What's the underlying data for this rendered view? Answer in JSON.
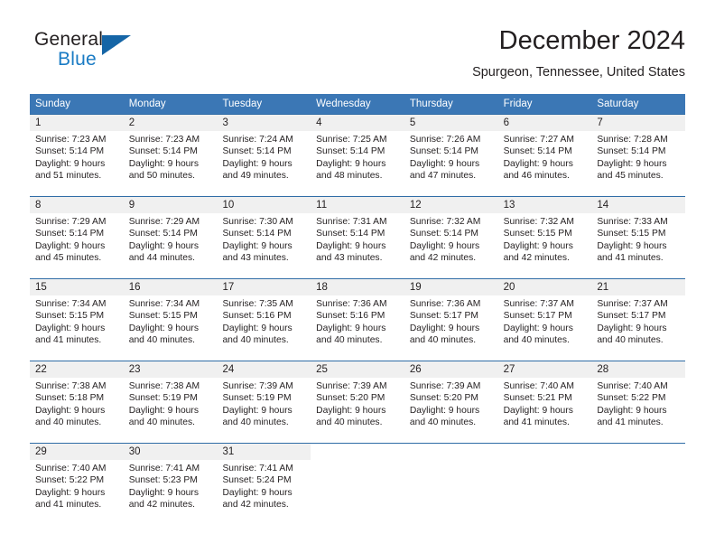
{
  "brand": {
    "name_part1": "General",
    "name_part2": "Blue",
    "logo_icon": "blue-triangle-icon",
    "accent_color": "#1a7bc4",
    "header_color": "#3b77b5"
  },
  "header": {
    "title": "December 2024",
    "subtitle": "Spurgeon, Tennessee, United States"
  },
  "calendar": {
    "weekdays": [
      "Sunday",
      "Monday",
      "Tuesday",
      "Wednesday",
      "Thursday",
      "Friday",
      "Saturday"
    ],
    "weeks": [
      [
        {
          "day": "1",
          "sunrise": "Sunrise: 7:23 AM",
          "sunset": "Sunset: 5:14 PM",
          "daylight1": "Daylight: 9 hours",
          "daylight2": "and 51 minutes."
        },
        {
          "day": "2",
          "sunrise": "Sunrise: 7:23 AM",
          "sunset": "Sunset: 5:14 PM",
          "daylight1": "Daylight: 9 hours",
          "daylight2": "and 50 minutes."
        },
        {
          "day": "3",
          "sunrise": "Sunrise: 7:24 AM",
          "sunset": "Sunset: 5:14 PM",
          "daylight1": "Daylight: 9 hours",
          "daylight2": "and 49 minutes."
        },
        {
          "day": "4",
          "sunrise": "Sunrise: 7:25 AM",
          "sunset": "Sunset: 5:14 PM",
          "daylight1": "Daylight: 9 hours",
          "daylight2": "and 48 minutes."
        },
        {
          "day": "5",
          "sunrise": "Sunrise: 7:26 AM",
          "sunset": "Sunset: 5:14 PM",
          "daylight1": "Daylight: 9 hours",
          "daylight2": "and 47 minutes."
        },
        {
          "day": "6",
          "sunrise": "Sunrise: 7:27 AM",
          "sunset": "Sunset: 5:14 PM",
          "daylight1": "Daylight: 9 hours",
          "daylight2": "and 46 minutes."
        },
        {
          "day": "7",
          "sunrise": "Sunrise: 7:28 AM",
          "sunset": "Sunset: 5:14 PM",
          "daylight1": "Daylight: 9 hours",
          "daylight2": "and 45 minutes."
        }
      ],
      [
        {
          "day": "8",
          "sunrise": "Sunrise: 7:29 AM",
          "sunset": "Sunset: 5:14 PM",
          "daylight1": "Daylight: 9 hours",
          "daylight2": "and 45 minutes."
        },
        {
          "day": "9",
          "sunrise": "Sunrise: 7:29 AM",
          "sunset": "Sunset: 5:14 PM",
          "daylight1": "Daylight: 9 hours",
          "daylight2": "and 44 minutes."
        },
        {
          "day": "10",
          "sunrise": "Sunrise: 7:30 AM",
          "sunset": "Sunset: 5:14 PM",
          "daylight1": "Daylight: 9 hours",
          "daylight2": "and 43 minutes."
        },
        {
          "day": "11",
          "sunrise": "Sunrise: 7:31 AM",
          "sunset": "Sunset: 5:14 PM",
          "daylight1": "Daylight: 9 hours",
          "daylight2": "and 43 minutes."
        },
        {
          "day": "12",
          "sunrise": "Sunrise: 7:32 AM",
          "sunset": "Sunset: 5:14 PM",
          "daylight1": "Daylight: 9 hours",
          "daylight2": "and 42 minutes."
        },
        {
          "day": "13",
          "sunrise": "Sunrise: 7:32 AM",
          "sunset": "Sunset: 5:15 PM",
          "daylight1": "Daylight: 9 hours",
          "daylight2": "and 42 minutes."
        },
        {
          "day": "14",
          "sunrise": "Sunrise: 7:33 AM",
          "sunset": "Sunset: 5:15 PM",
          "daylight1": "Daylight: 9 hours",
          "daylight2": "and 41 minutes."
        }
      ],
      [
        {
          "day": "15",
          "sunrise": "Sunrise: 7:34 AM",
          "sunset": "Sunset: 5:15 PM",
          "daylight1": "Daylight: 9 hours",
          "daylight2": "and 41 minutes."
        },
        {
          "day": "16",
          "sunrise": "Sunrise: 7:34 AM",
          "sunset": "Sunset: 5:15 PM",
          "daylight1": "Daylight: 9 hours",
          "daylight2": "and 40 minutes."
        },
        {
          "day": "17",
          "sunrise": "Sunrise: 7:35 AM",
          "sunset": "Sunset: 5:16 PM",
          "daylight1": "Daylight: 9 hours",
          "daylight2": "and 40 minutes."
        },
        {
          "day": "18",
          "sunrise": "Sunrise: 7:36 AM",
          "sunset": "Sunset: 5:16 PM",
          "daylight1": "Daylight: 9 hours",
          "daylight2": "and 40 minutes."
        },
        {
          "day": "19",
          "sunrise": "Sunrise: 7:36 AM",
          "sunset": "Sunset: 5:17 PM",
          "daylight1": "Daylight: 9 hours",
          "daylight2": "and 40 minutes."
        },
        {
          "day": "20",
          "sunrise": "Sunrise: 7:37 AM",
          "sunset": "Sunset: 5:17 PM",
          "daylight1": "Daylight: 9 hours",
          "daylight2": "and 40 minutes."
        },
        {
          "day": "21",
          "sunrise": "Sunrise: 7:37 AM",
          "sunset": "Sunset: 5:17 PM",
          "daylight1": "Daylight: 9 hours",
          "daylight2": "and 40 minutes."
        }
      ],
      [
        {
          "day": "22",
          "sunrise": "Sunrise: 7:38 AM",
          "sunset": "Sunset: 5:18 PM",
          "daylight1": "Daylight: 9 hours",
          "daylight2": "and 40 minutes."
        },
        {
          "day": "23",
          "sunrise": "Sunrise: 7:38 AM",
          "sunset": "Sunset: 5:19 PM",
          "daylight1": "Daylight: 9 hours",
          "daylight2": "and 40 minutes."
        },
        {
          "day": "24",
          "sunrise": "Sunrise: 7:39 AM",
          "sunset": "Sunset: 5:19 PM",
          "daylight1": "Daylight: 9 hours",
          "daylight2": "and 40 minutes."
        },
        {
          "day": "25",
          "sunrise": "Sunrise: 7:39 AM",
          "sunset": "Sunset: 5:20 PM",
          "daylight1": "Daylight: 9 hours",
          "daylight2": "and 40 minutes."
        },
        {
          "day": "26",
          "sunrise": "Sunrise: 7:39 AM",
          "sunset": "Sunset: 5:20 PM",
          "daylight1": "Daylight: 9 hours",
          "daylight2": "and 40 minutes."
        },
        {
          "day": "27",
          "sunrise": "Sunrise: 7:40 AM",
          "sunset": "Sunset: 5:21 PM",
          "daylight1": "Daylight: 9 hours",
          "daylight2": "and 41 minutes."
        },
        {
          "day": "28",
          "sunrise": "Sunrise: 7:40 AM",
          "sunset": "Sunset: 5:22 PM",
          "daylight1": "Daylight: 9 hours",
          "daylight2": "and 41 minutes."
        }
      ],
      [
        {
          "day": "29",
          "sunrise": "Sunrise: 7:40 AM",
          "sunset": "Sunset: 5:22 PM",
          "daylight1": "Daylight: 9 hours",
          "daylight2": "and 41 minutes."
        },
        {
          "day": "30",
          "sunrise": "Sunrise: 7:41 AM",
          "sunset": "Sunset: 5:23 PM",
          "daylight1": "Daylight: 9 hours",
          "daylight2": "and 42 minutes."
        },
        {
          "day": "31",
          "sunrise": "Sunrise: 7:41 AM",
          "sunset": "Sunset: 5:24 PM",
          "daylight1": "Daylight: 9 hours",
          "daylight2": "and 42 minutes."
        },
        {
          "day": "",
          "sunrise": "",
          "sunset": "",
          "daylight1": "",
          "daylight2": ""
        },
        {
          "day": "",
          "sunrise": "",
          "sunset": "",
          "daylight1": "",
          "daylight2": ""
        },
        {
          "day": "",
          "sunrise": "",
          "sunset": "",
          "daylight1": "",
          "daylight2": ""
        },
        {
          "day": "",
          "sunrise": "",
          "sunset": "",
          "daylight1": "",
          "daylight2": ""
        }
      ]
    ]
  }
}
